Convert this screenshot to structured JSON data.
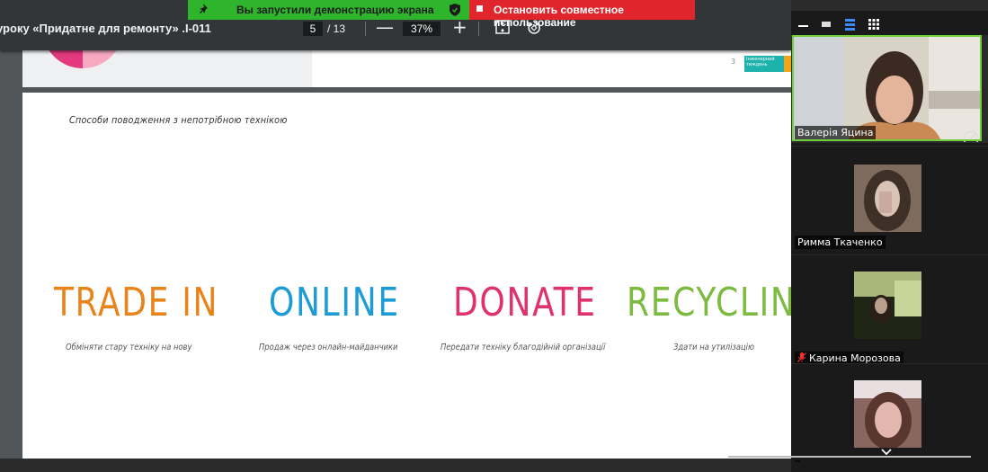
{
  "toolbar": {
    "doc_title": "уроку «Придатне для ремонту» .I-011",
    "page_current": "5",
    "page_total": "/ 13",
    "zoom": "37%",
    "zoom_out": "—",
    "zoom_in": "+"
  },
  "share_bar": {
    "status_text": "Вы запустили демонстрацию экрана",
    "stop_text": "Остановить совместное использование",
    "status_color": "#2fb52b",
    "stop_color": "#e0262c"
  },
  "prev_page": {
    "page_number": "3",
    "badge_text": "Інженерний тиждень"
  },
  "page": {
    "subtitle": "Способи поводження з непотрібною технікою",
    "options": [
      {
        "title": "TRADE IN",
        "desc": "Обміняти стару техніку на нову",
        "color": "#e8841a"
      },
      {
        "title": "ONLINE",
        "desc": "Продаж через онлайн-майданчики",
        "color": "#1c9bd6"
      },
      {
        "title": "DONATE",
        "desc": "Передати техніку благодійній організації",
        "color": "#e0306e"
      },
      {
        "title": "RECYCLING",
        "desc": "Здати на утилізацію",
        "color": "#7cbb3f"
      }
    ]
  },
  "participants": [
    {
      "name": "Валерія Яцина",
      "muted": false,
      "active": true
    },
    {
      "name": "Римма Ткаченко",
      "muted": false,
      "active": false
    },
    {
      "name": "Карина Морозова",
      "muted": true,
      "active": false
    },
    {
      "name": "",
      "muted": false,
      "active": false
    }
  ]
}
